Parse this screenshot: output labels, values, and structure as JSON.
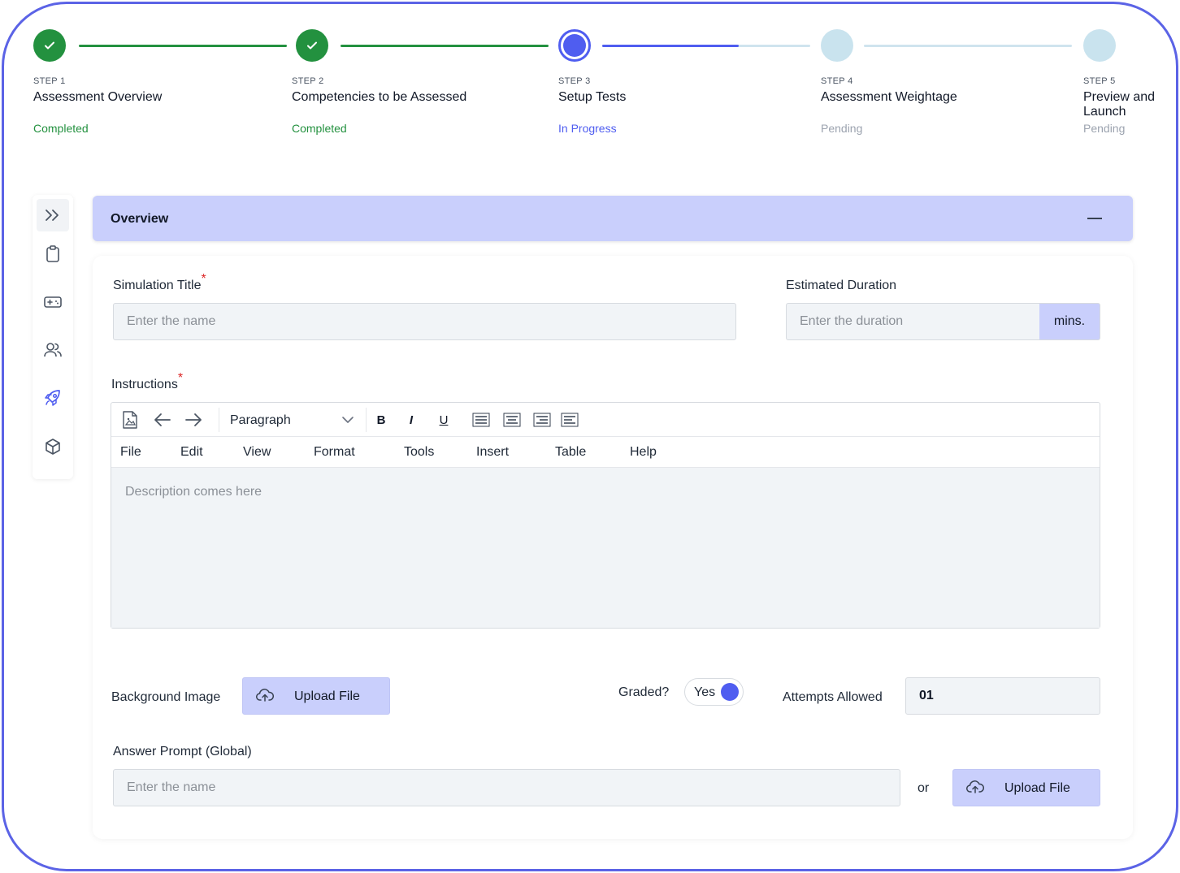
{
  "stepper": {
    "steps": [
      {
        "num": "STEP 1",
        "title": "Assessment Overview",
        "status": "Completed",
        "state": "done"
      },
      {
        "num": "STEP 2",
        "title": "Competencies to be Assessed",
        "status": "Completed",
        "state": "done"
      },
      {
        "num": "STEP 3",
        "title": "Setup Tests",
        "status": "In Progress",
        "state": "active"
      },
      {
        "num": "STEP 4",
        "title": "Assessment Weightage",
        "status": "Pending",
        "state": "pending"
      },
      {
        "num": "STEP 5",
        "title": "Preview and Launch",
        "status": "Pending",
        "state": "pending"
      }
    ]
  },
  "sidebar": {
    "items": [
      "expand-icon",
      "clipboard-icon",
      "gamepad-icon",
      "users-icon",
      "rocket-icon",
      "cube-icon"
    ]
  },
  "overview": {
    "title": "Overview"
  },
  "form": {
    "simulation_title": {
      "label": "Simulation Title",
      "required": "*",
      "placeholder": "Enter the name"
    },
    "duration": {
      "label": "Estimated Duration",
      "placeholder": "Enter the duration",
      "suffix": "mins."
    },
    "instructions": {
      "label": "Instructions",
      "required": "*",
      "block_format": "Paragraph",
      "format_buttons": {
        "bold": "B",
        "italic": "I",
        "underline": "U"
      },
      "menu": [
        "File",
        "Edit",
        "View",
        "Format",
        "Tools",
        "Insert",
        "Table",
        "Help"
      ],
      "placeholder": "Description comes here"
    },
    "background_image": {
      "label": "Background Image",
      "button": "Upload File"
    },
    "graded": {
      "label": "Graded?",
      "value": "Yes"
    },
    "attempts": {
      "label": "Attempts Allowed",
      "value": "01"
    },
    "answer_prompt": {
      "label": "Answer Prompt (Global)",
      "placeholder": "Enter the name",
      "or": "or",
      "button": "Upload File"
    }
  },
  "colors": {
    "accent": "#4f5df0",
    "success": "#23913f",
    "pending": "#c9e3ee",
    "soft_accent": "#c9cffc"
  }
}
